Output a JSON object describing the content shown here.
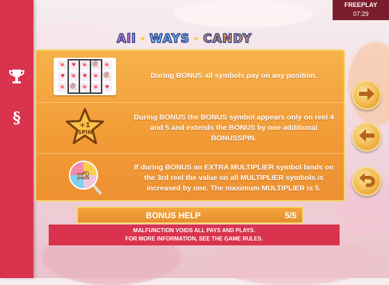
{
  "topbar": {
    "mode_label": "FREEPLAY",
    "clock": "07:29"
  },
  "logo": {
    "word1": "All",
    "word2": "WAYS",
    "word3": "CANDY"
  },
  "sidebar": {
    "items": [
      {
        "name": "trophy-icon",
        "label": ""
      },
      {
        "name": "section-icon",
        "label": "§"
      }
    ]
  },
  "rules": [
    {
      "icon": "reels-all-positions-icon",
      "text": "During BONUS all symbols pay on any position."
    },
    {
      "icon": "bonus-spin-star-icon",
      "badge": "+1 SPIN",
      "text": "During BONUS the BONUS symbol appears only on reel 4 and 5 and extends the BONUS by one additional BONUSSPIN."
    },
    {
      "icon": "multiplier-lollipop-icon",
      "badge": "x2",
      "text": "If during BONUS an EXTRA MULTIPLIER symbol lands on the 3rd reel the value on all MULTIPLIER symbols is increased by one. The maximum MULTIPLIER is 5."
    }
  ],
  "help_bar": {
    "title": "BONUS HELP",
    "page": "5/5"
  },
  "disclaimer": {
    "line1": "MALFUNCTION VOIDS ALL PAYS AND PLAYS.",
    "line2": "FOR MORE INFORMATION, SEE THE GAME RULES."
  },
  "nav": [
    {
      "name": "next-arrow-icon"
    },
    {
      "name": "previous-arrow-icon"
    },
    {
      "name": "return-arrow-icon"
    }
  ],
  "colors": {
    "sidebar": "#d9334d",
    "panel": "#f19a36",
    "panel_border": "#f7d66d",
    "text": "#ffffff"
  }
}
